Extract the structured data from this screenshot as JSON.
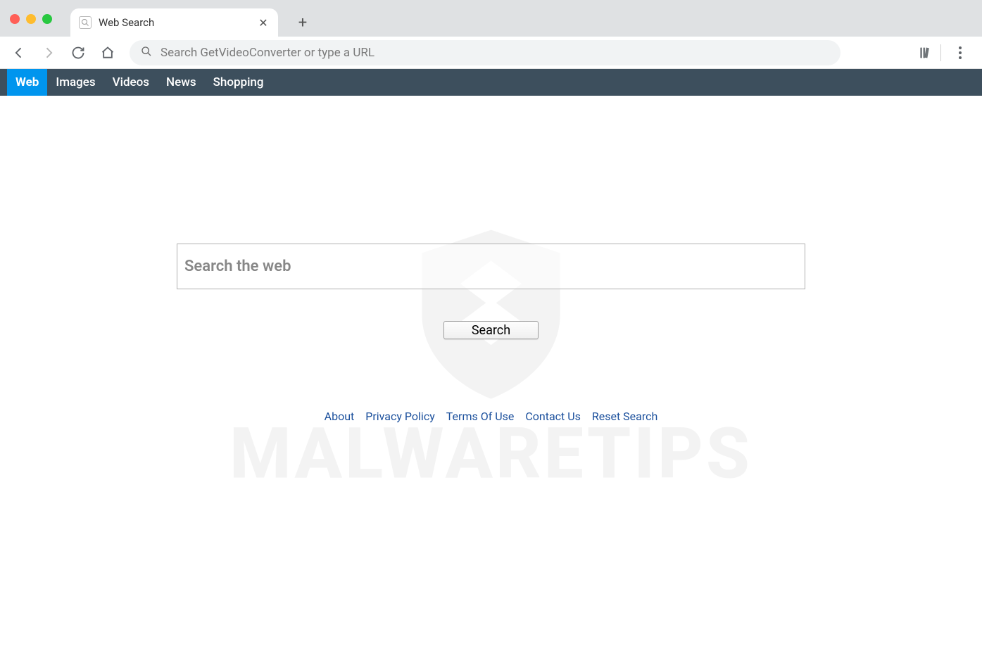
{
  "window": {
    "tab_title": "Web Search"
  },
  "omnibox": {
    "placeholder": "Search GetVideoConverter or type a URL"
  },
  "page_nav": {
    "items": [
      {
        "label": "Web",
        "active": true
      },
      {
        "label": "Images",
        "active": false
      },
      {
        "label": "Videos",
        "active": false
      },
      {
        "label": "News",
        "active": false
      },
      {
        "label": "Shopping",
        "active": false
      }
    ]
  },
  "main": {
    "search_placeholder": "Search the web",
    "search_button_label": "Search"
  },
  "footer": {
    "links": [
      {
        "label": "About"
      },
      {
        "label": "Privacy Policy"
      },
      {
        "label": "Terms Of Use"
      },
      {
        "label": "Contact Us"
      },
      {
        "label": "Reset Search"
      }
    ]
  },
  "watermark": {
    "text": "MALWARETIPS"
  }
}
